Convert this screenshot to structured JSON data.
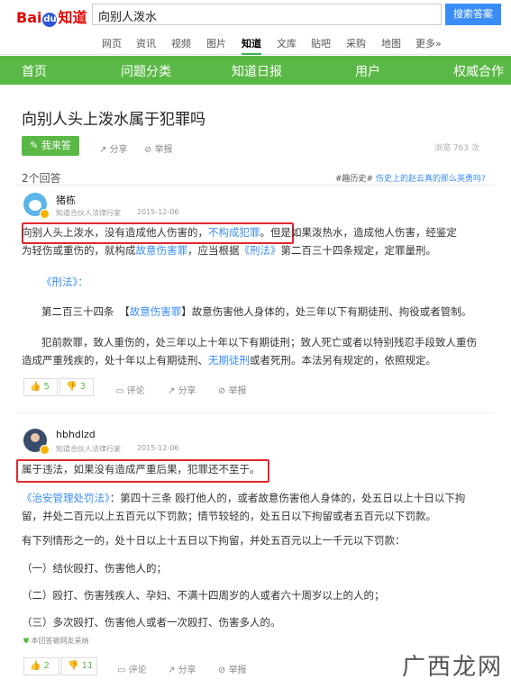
{
  "header": {
    "logo_bai": "Bai",
    "logo_du": "du",
    "logo_zhidao": "知道",
    "search_value": "向别人泼水",
    "search_button": "搜索答案"
  },
  "nav": [
    "网页",
    "资讯",
    "视频",
    "图片",
    "知道",
    "文库",
    "贴吧",
    "采购",
    "地图",
    "更多»"
  ],
  "nav_active": "知道",
  "greenbar": [
    "首页",
    "问题分类",
    "知道日报",
    "用户",
    "权威合作"
  ],
  "question": {
    "title": "向别人头上泼水属于犯罪吗",
    "answer_button": "我来答",
    "share": "分享",
    "report": "举报",
    "views": "浏览 763 次"
  },
  "answers_count": "2个回答",
  "history": {
    "tag": "#趣历史#",
    "text": "伤史上的赵云真的那么英勇吗?"
  },
  "answers": [
    {
      "user": "猪栋",
      "role": "知道合伙人法律行家",
      "date": "2015-12-06",
      "p1": {
        "a": "向别人头上泼水，没有造成他人伤害的，",
        "link": "不构成犯罪",
        "b": "。但是如果泼热水，造成他人伤害，经鉴定",
        "c": "为轻伤或重伤的，就构成",
        "link2": "故意伤害罪",
        "d": "，应当根据",
        "link3": "《刑法》",
        "e": "第二百三十四条规定，定罪量刑。"
      },
      "law_title": "《刑法》：",
      "p2": {
        "a": "第二百三十四条　【",
        "link": "故意伤害罪",
        "b": "】故意伤害他人身体的，处三年以下有期徒刑、拘役或者管制。"
      },
      "p3": {
        "a": "犯前款罪，致人重伤的，处三年以上十年以下有期徒刑；致人死亡或者以特别残忍手段致人重伤",
        "b": "造成严重残疾的，处十年以上有期徒刑、",
        "link": "无期徒刑",
        "c": "或者死刑。本法另有规定的，依照规定。"
      },
      "up": "5",
      "down": "3",
      "comment": "评论",
      "share": "分享",
      "report": "举报"
    },
    {
      "user": "hbhdlzd",
      "role": "知道合伙人法律行家",
      "date": "2015-12-06",
      "p1": "属于违法，如果没有造成严重后果，犯罪还不至于。",
      "p2": {
        "link": "《治安管理处罚法》",
        "a": "：第四十三条 殴打他人的，或者故意伤害他人身体的，处五日以上十日以下拘",
        "b": "留，并处二百元以上五百元以下罚款；情节较轻的，处五日以下拘留或者五百元以下罚款。"
      },
      "p3": "有下列情形之一的，处十日以上十五日以下拘留，并处五百元以上一千元以下罚款：",
      "items": [
        "（一）结伙殴打、伤害他人的；",
        "（二）殴打、伤害残疾人、孕妇、不满十四周岁的人或者六十周岁以上的人的；",
        "（三）多次殴打、伤害他人或者一次殴打、伤害多人的。"
      ],
      "adopted": "本回答被网友采纳",
      "up": "2",
      "down": "11",
      "comment": "评论",
      "share": "分享",
      "report": "举报"
    }
  ],
  "watermark": "广西龙网",
  "colors": {
    "green": "#5ab946",
    "link": "#3a8df6",
    "highlight": "#e0282e",
    "brand_red": "#e10602"
  }
}
